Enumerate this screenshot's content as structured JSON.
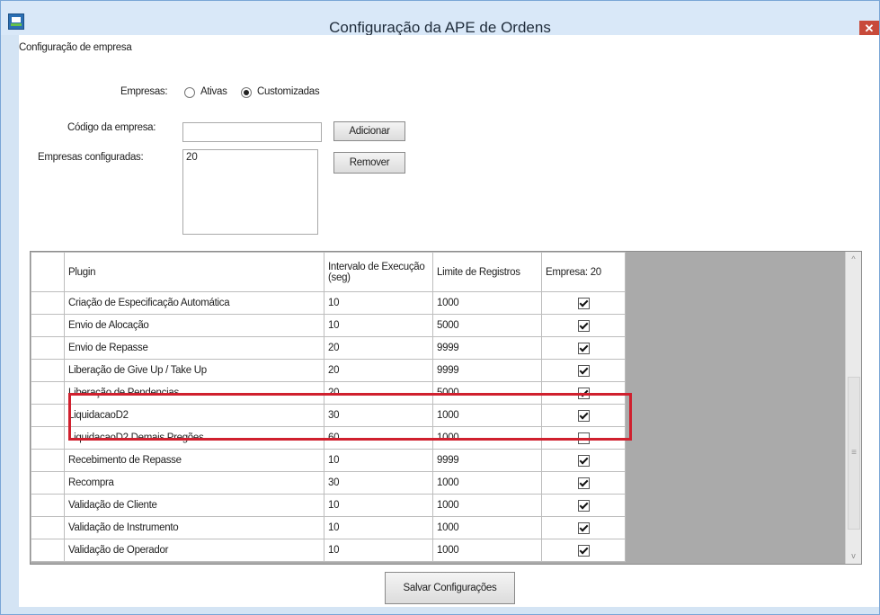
{
  "window": {
    "title": "Configuração da APE de Ordens",
    "app_icon": "app-logo-icon",
    "close_icon": "close-icon",
    "close_glyph": "✕"
  },
  "company_config": {
    "group_label": "Configuração de empresa",
    "companies_label": "Empresas:",
    "radio_active_label": "Ativas",
    "radio_custom_label": "Customizadas",
    "selected": "Customizadas",
    "code_label": "Código da empresa:",
    "code_value": "",
    "add_button": "Adicionar",
    "configured_label": "Empresas configuradas:",
    "configured_list": [
      "20"
    ],
    "remove_button": "Remover"
  },
  "grid": {
    "columns": [
      "Plugin",
      "Intervalo de Execução (seg)",
      "Limite de Registros",
      "Empresa: 20"
    ],
    "rows": [
      {
        "plugin": "Criação de Especificação Automática",
        "interval": "10",
        "limit": "1000",
        "enabled": true
      },
      {
        "plugin": "Envio de Alocação",
        "interval": "10",
        "limit": "5000",
        "enabled": true
      },
      {
        "plugin": "Envio de Repasse",
        "interval": "20",
        "limit": "9999",
        "enabled": true
      },
      {
        "plugin": "Liberação de Give Up / Take Up",
        "interval": "20",
        "limit": "9999",
        "enabled": true
      },
      {
        "plugin": "Liberação de Pendencias",
        "interval": "20",
        "limit": "5000",
        "enabled": true
      },
      {
        "plugin": "LiquidacaoD2",
        "interval": "30",
        "limit": "1000",
        "enabled": true
      },
      {
        "plugin": "LiquidacaoD2 Demais Pregões",
        "interval": "60",
        "limit": "1000",
        "enabled": false
      },
      {
        "plugin": "Recebimento de Repasse",
        "interval": "10",
        "limit": "9999",
        "enabled": true
      },
      {
        "plugin": "Recompra",
        "interval": "30",
        "limit": "1000",
        "enabled": true
      },
      {
        "plugin": "Validação de Cliente",
        "interval": "10",
        "limit": "1000",
        "enabled": true
      },
      {
        "plugin": "Validação de Instrumento",
        "interval": "10",
        "limit": "1000",
        "enabled": true
      },
      {
        "plugin": "Validação de Operador",
        "interval": "10",
        "limit": "1000",
        "enabled": true
      }
    ],
    "highlighted_rows": [
      "LiquidacaoD2",
      "LiquidacaoD2 Demais Pregões"
    ],
    "highlight_color": "#d0202e",
    "scroll_up_glyph": "^",
    "scroll_down_glyph": "v",
    "scroll_grip_glyph": "≡"
  },
  "footer": {
    "save_button": "Salvar Configurações"
  }
}
